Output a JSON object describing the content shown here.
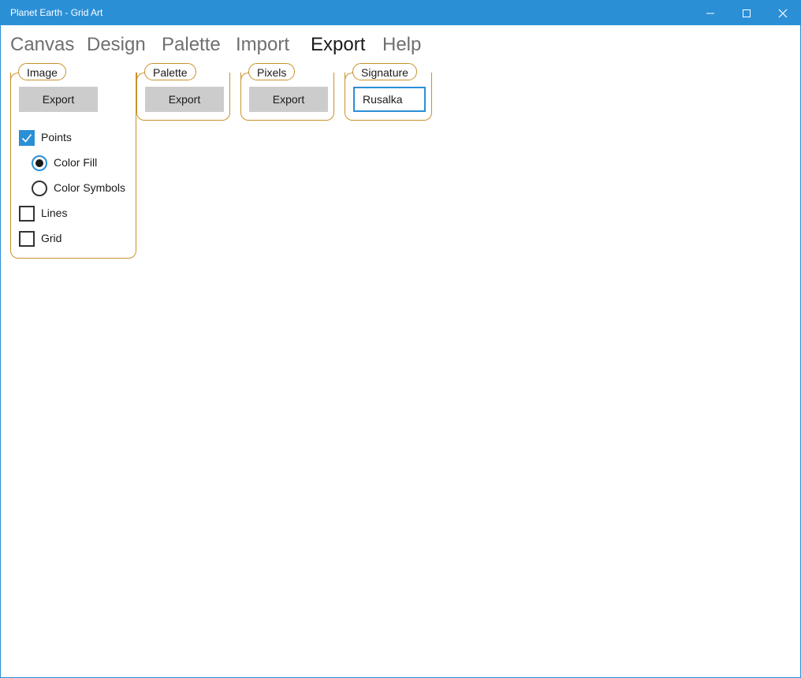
{
  "window": {
    "title": "Planet Earth - Grid Art",
    "accent_color": "#2b8fd6"
  },
  "nav": {
    "items": [
      {
        "label": "Canvas",
        "active": false
      },
      {
        "label": "Design",
        "active": false
      },
      {
        "label": "Palette",
        "active": false
      },
      {
        "label": "Import",
        "active": false
      },
      {
        "label": "Export",
        "active": true
      },
      {
        "label": "Help",
        "active": false
      }
    ]
  },
  "groups": {
    "image": {
      "label": "Image",
      "button": "Export",
      "options": {
        "points": {
          "label": "Points",
          "checked": true
        },
        "color_fill": {
          "label": "Color Fill",
          "selected": true
        },
        "color_symbols": {
          "label": "Color Symbols",
          "selected": false
        },
        "lines": {
          "label": "Lines",
          "checked": false
        },
        "grid": {
          "label": "Grid",
          "checked": false
        }
      }
    },
    "palette": {
      "label": "Palette",
      "button": "Export"
    },
    "pixels": {
      "label": "Pixels",
      "button": "Export"
    },
    "signature": {
      "label": "Signature",
      "value": "Rusalka"
    }
  },
  "colors": {
    "group_border": "#c8922a",
    "button_bg": "#cccccc",
    "nav_inactive": "#6f6f6f",
    "nav_active": "#1a1a1a"
  }
}
